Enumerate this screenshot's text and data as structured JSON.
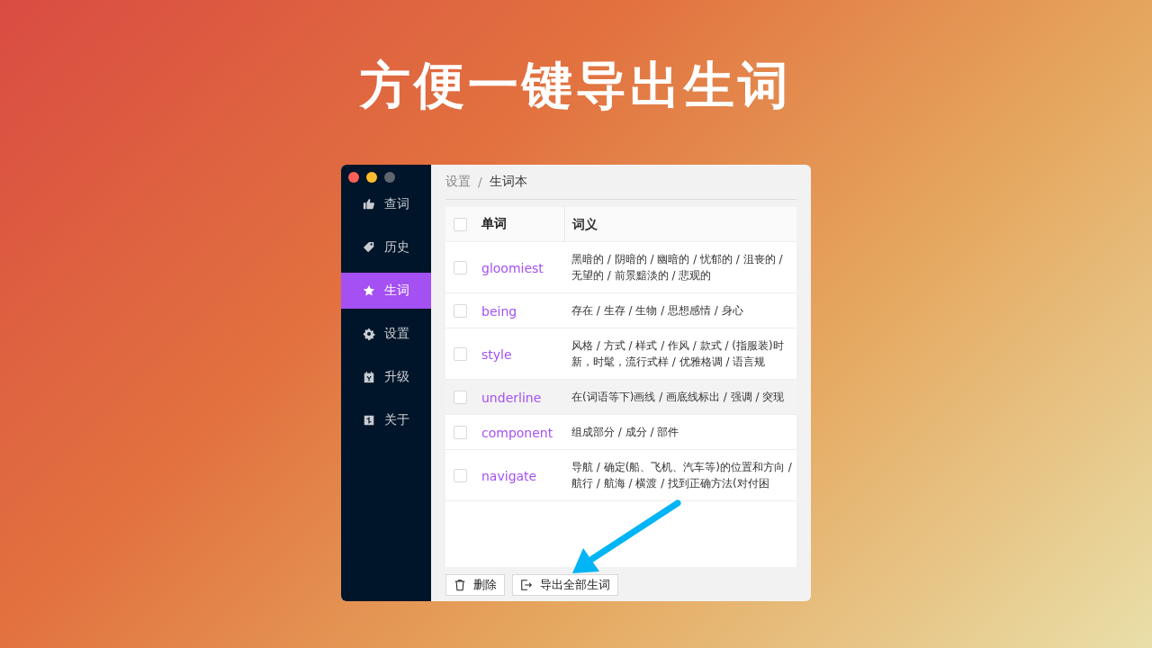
{
  "headline": "方便一键导出生词",
  "sidebar": {
    "items": [
      {
        "label": "查词",
        "selected": false
      },
      {
        "label": "历史",
        "selected": false
      },
      {
        "label": "生词",
        "selected": true
      },
      {
        "label": "设置",
        "selected": false
      },
      {
        "label": "升级",
        "selected": false
      },
      {
        "label": "关于",
        "selected": false
      }
    ]
  },
  "breadcrumb": [
    "设置",
    "生词本"
  ],
  "breadcrumb_separator": "/",
  "table": {
    "header_checked": false,
    "columns": [
      "单词",
      "词义"
    ],
    "rows": [
      {
        "word": "gloomiest",
        "meaning": "黑暗的 / 阴暗的 / 幽暗的 / 忧郁的 / 沮丧的 / 无望的 / 前景黯淡的 / 悲观的",
        "checked": false,
        "highlighted": false
      },
      {
        "word": "being",
        "meaning": "存在 / 生存 / 生物 / 思想感情 / 身心",
        "checked": false,
        "highlighted": false
      },
      {
        "word": "style",
        "meaning": "风格 / 方式 / 样式 / 作风 / 款式 / (指服装)时新，时髦，流行式样 / 优雅格调 / 语言规",
        "checked": false,
        "highlighted": false
      },
      {
        "word": "underline",
        "meaning": "在(词语等下)画线 / 画底线标出 / 强调 / 突现",
        "checked": false,
        "highlighted": true
      },
      {
        "word": "component",
        "meaning": "组成部分 / 成分 / 部件",
        "checked": false,
        "highlighted": false
      },
      {
        "word": "navigate",
        "meaning": "导航 / 确定(船、飞机、汽车等)的位置和方向 / 航行 / 航海 / 横渡 / 找到正确方法(对付困",
        "checked": false,
        "highlighted": false
      }
    ]
  },
  "buttons": [
    {
      "label": "删除"
    },
    {
      "label": "导出全部生词"
    }
  ]
}
